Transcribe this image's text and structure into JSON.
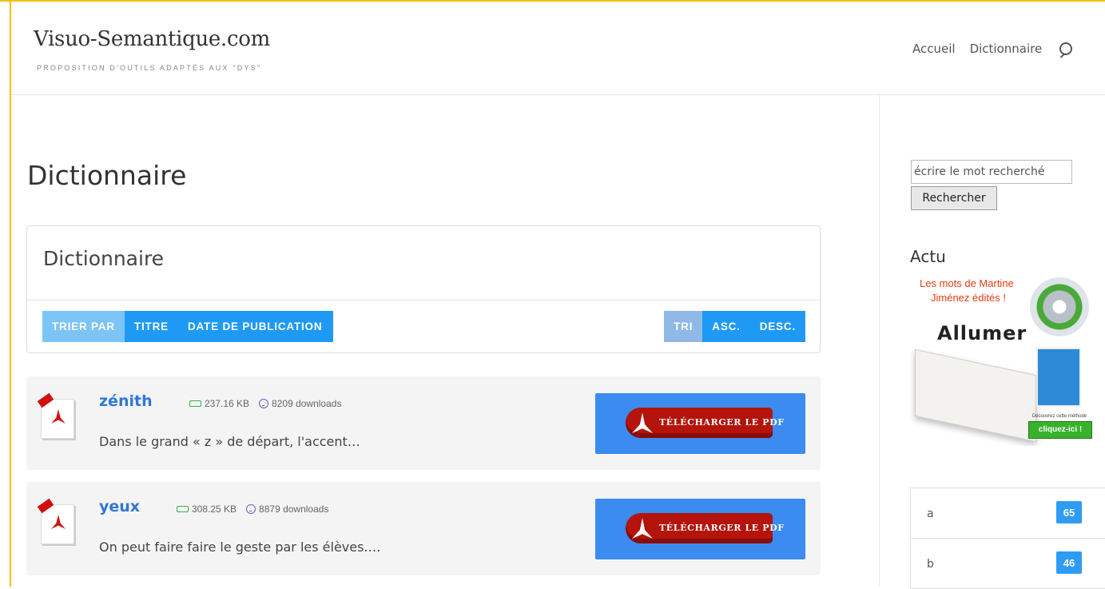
{
  "header": {
    "site_title": "Visuo-Semantique.com",
    "tagline": "PROPOSITION D'OUTILS ADAPTÉS AUX \"DYS\"",
    "nav": [
      {
        "label": "Accueil"
      },
      {
        "label": "Dictionnaire"
      }
    ]
  },
  "page": {
    "title": "Dictionnaire"
  },
  "panel": {
    "title": "Dictionnaire",
    "sort_by_label": "TRIER PAR",
    "sort_by_options": [
      "TITRE",
      "DATE DE PUBLICATION"
    ],
    "order_label": "TRI",
    "order_options": [
      "ASC.",
      "DESC."
    ]
  },
  "items": [
    {
      "title": "zénith",
      "size": "237.16 KB",
      "downloads": "8209 downloads",
      "description": "Dans le grand « z » de départ, l'accent…",
      "download_label": "TÉLÉCHARGER LE PDF"
    },
    {
      "title": "yeux",
      "size": "308.25 KB",
      "downloads": "8879 downloads",
      "description": "On peut faire faire le geste par les élèves.…",
      "download_label": "TÉLÉCHARGER LE PDF"
    }
  ],
  "sidebar": {
    "search_placeholder": "écrire le mot recherché",
    "search_button": "Rechercher",
    "actu_title": "Actu",
    "promo": {
      "line1": "Les mots de Martine",
      "line2": "Jiménez édités !",
      "word": "Allumer",
      "cta_small": "Découvrez cette méthode",
      "cta": "cliquez-ici !"
    },
    "letters": [
      {
        "letter": "a",
        "count": "65"
      },
      {
        "letter": "b",
        "count": "46"
      }
    ]
  },
  "colors": {
    "accent_blue": "#1e9af5",
    "frame_yellow": "#f2c200",
    "link_blue": "#3077d6"
  }
}
